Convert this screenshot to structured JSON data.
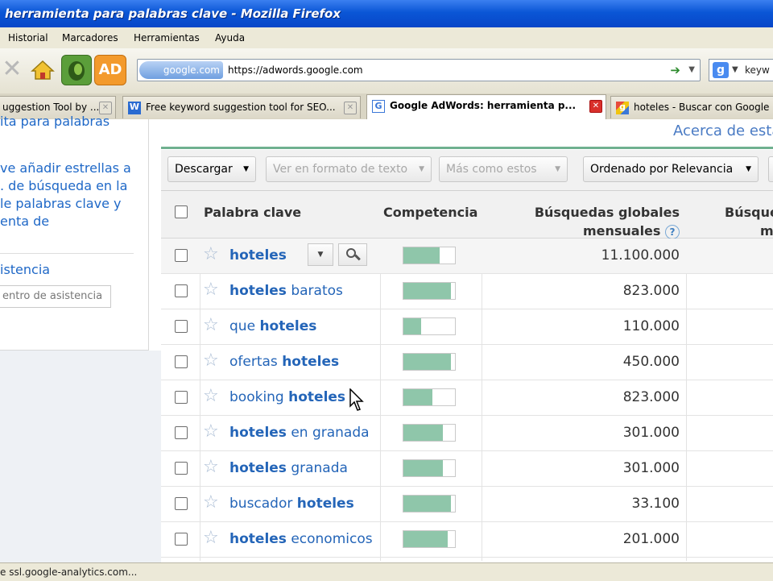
{
  "window": {
    "title": "herramienta para palabras clave - Mozilla Firefox"
  },
  "menu": {
    "items": [
      "Historial",
      "Marcadores",
      "Herramientas",
      "Ayuda"
    ]
  },
  "navbar": {
    "ad_button": "AD",
    "site_identity": "google.com",
    "url": "https://adwords.google.com",
    "search_engine": "g",
    "search_text": "keyw"
  },
  "tabs": [
    {
      "label": "uggestion Tool by ...",
      "favicon": "page",
      "active": false
    },
    {
      "label": "Free keyword suggestion tool for SEO...",
      "favicon": "W",
      "active": false
    },
    {
      "label": "Google AdWords: herramienta p...",
      "favicon": "G",
      "active": true
    },
    {
      "label": "hoteles - Buscar con Google",
      "favicon": "g",
      "active": false
    }
  ],
  "sidebar": {
    "line1": "ita para palabras",
    "line2": "ve añadir estrellas a",
    "line3": ". de búsqueda en la",
    "line4": "le palabras clave y",
    "line5": "enta de",
    "help_link": "istencia",
    "help_search_placeholder": "entro de asistencia"
  },
  "main": {
    "about_link": "Acerca de esta",
    "toolbar": {
      "download": "Descargar",
      "text_view": "Ver en formato de texto",
      "more_like": "Más como estos",
      "sort": "Ordenado por Relevancia"
    },
    "columns": {
      "keyword": "Palabra clave",
      "competition": "Competencia",
      "global_line1": "Búsquedas globales",
      "global_line2": "mensuales",
      "help": "?",
      "local_line1": "Búsque",
      "local_line2": "m"
    }
  },
  "rows": [
    {
      "pre": "",
      "bold": "hoteles",
      "post": "",
      "competition": 0.7,
      "global": "11.100.000"
    },
    {
      "pre": "",
      "bold": "hoteles",
      "post": " baratos",
      "competition": 0.92,
      "global": "823.000"
    },
    {
      "pre": "que ",
      "bold": "hoteles",
      "post": "",
      "competition": 0.35,
      "global": "110.000"
    },
    {
      "pre": "ofertas ",
      "bold": "hoteles",
      "post": "",
      "competition": 0.92,
      "global": "450.000"
    },
    {
      "pre": "booking ",
      "bold": "hoteles",
      "post": "",
      "competition": 0.56,
      "global": "823.000"
    },
    {
      "pre": "",
      "bold": "hoteles",
      "post": " en granada",
      "competition": 0.76,
      "global": "301.000"
    },
    {
      "pre": "",
      "bold": "hoteles",
      "post": " granada",
      "competition": 0.76,
      "global": "301.000"
    },
    {
      "pre": "buscador ",
      "bold": "hoteles",
      "post": "",
      "competition": 0.92,
      "global": "33.100"
    },
    {
      "pre": "",
      "bold": "hoteles",
      "post": " economicos",
      "competition": 0.86,
      "global": "201.000"
    }
  ],
  "status": {
    "text": "e ssl.google-analytics.com..."
  }
}
